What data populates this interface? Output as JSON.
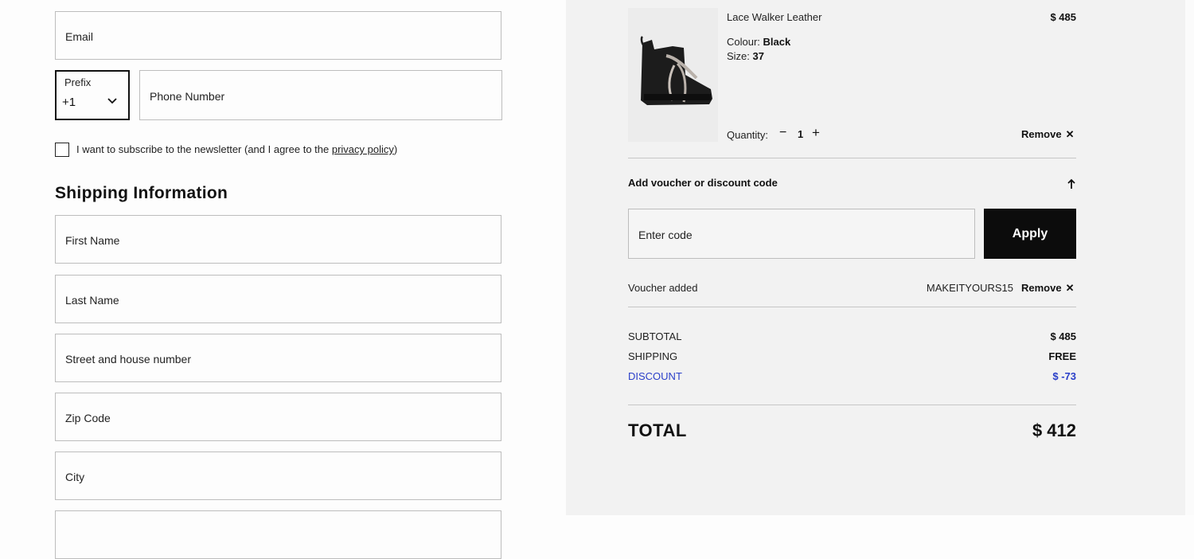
{
  "contact": {
    "email_placeholder": "Email",
    "prefix_label": "Prefix",
    "prefix_value": "+1",
    "phone_placeholder": "Phone Number"
  },
  "newsletter": {
    "text": "I want to subscribe to the newsletter (and I agree to the ",
    "link": "privacy policy",
    "suffix": ")"
  },
  "shipping": {
    "heading": "Shipping Information",
    "first_name_placeholder": "First Name",
    "last_name_placeholder": "Last Name",
    "street_placeholder": "Street and house number",
    "zip_placeholder": "Zip Code",
    "city_placeholder": "City"
  },
  "cart": {
    "item": {
      "name": "Lace Walker Leather",
      "price": "$ 485",
      "colour_label": "Colour:",
      "colour": "Black",
      "size_label": "Size:",
      "size": "37",
      "quantity_label": "Quantity:",
      "quantity": "1",
      "remove_label": "Remove"
    }
  },
  "voucher": {
    "toggle_label": "Add voucher or discount code",
    "input_placeholder": "Enter code",
    "apply_label": "Apply",
    "added_label": "Voucher added",
    "code": "MAKEITYOURS15",
    "remove_label": "Remove"
  },
  "summary": {
    "subtotal_label": "SUBTOTAL",
    "subtotal": "$ 485",
    "shipping_label": "SHIPPING",
    "shipping": "FREE",
    "discount_label": "DISCOUNT",
    "discount": "$ -73",
    "total_label": "TOTAL",
    "total": "$ 412"
  },
  "colors": {
    "accent_dark": "#0c0c0c",
    "discount": "#2a3fc9",
    "summary_bg": "#f2f2f2"
  }
}
